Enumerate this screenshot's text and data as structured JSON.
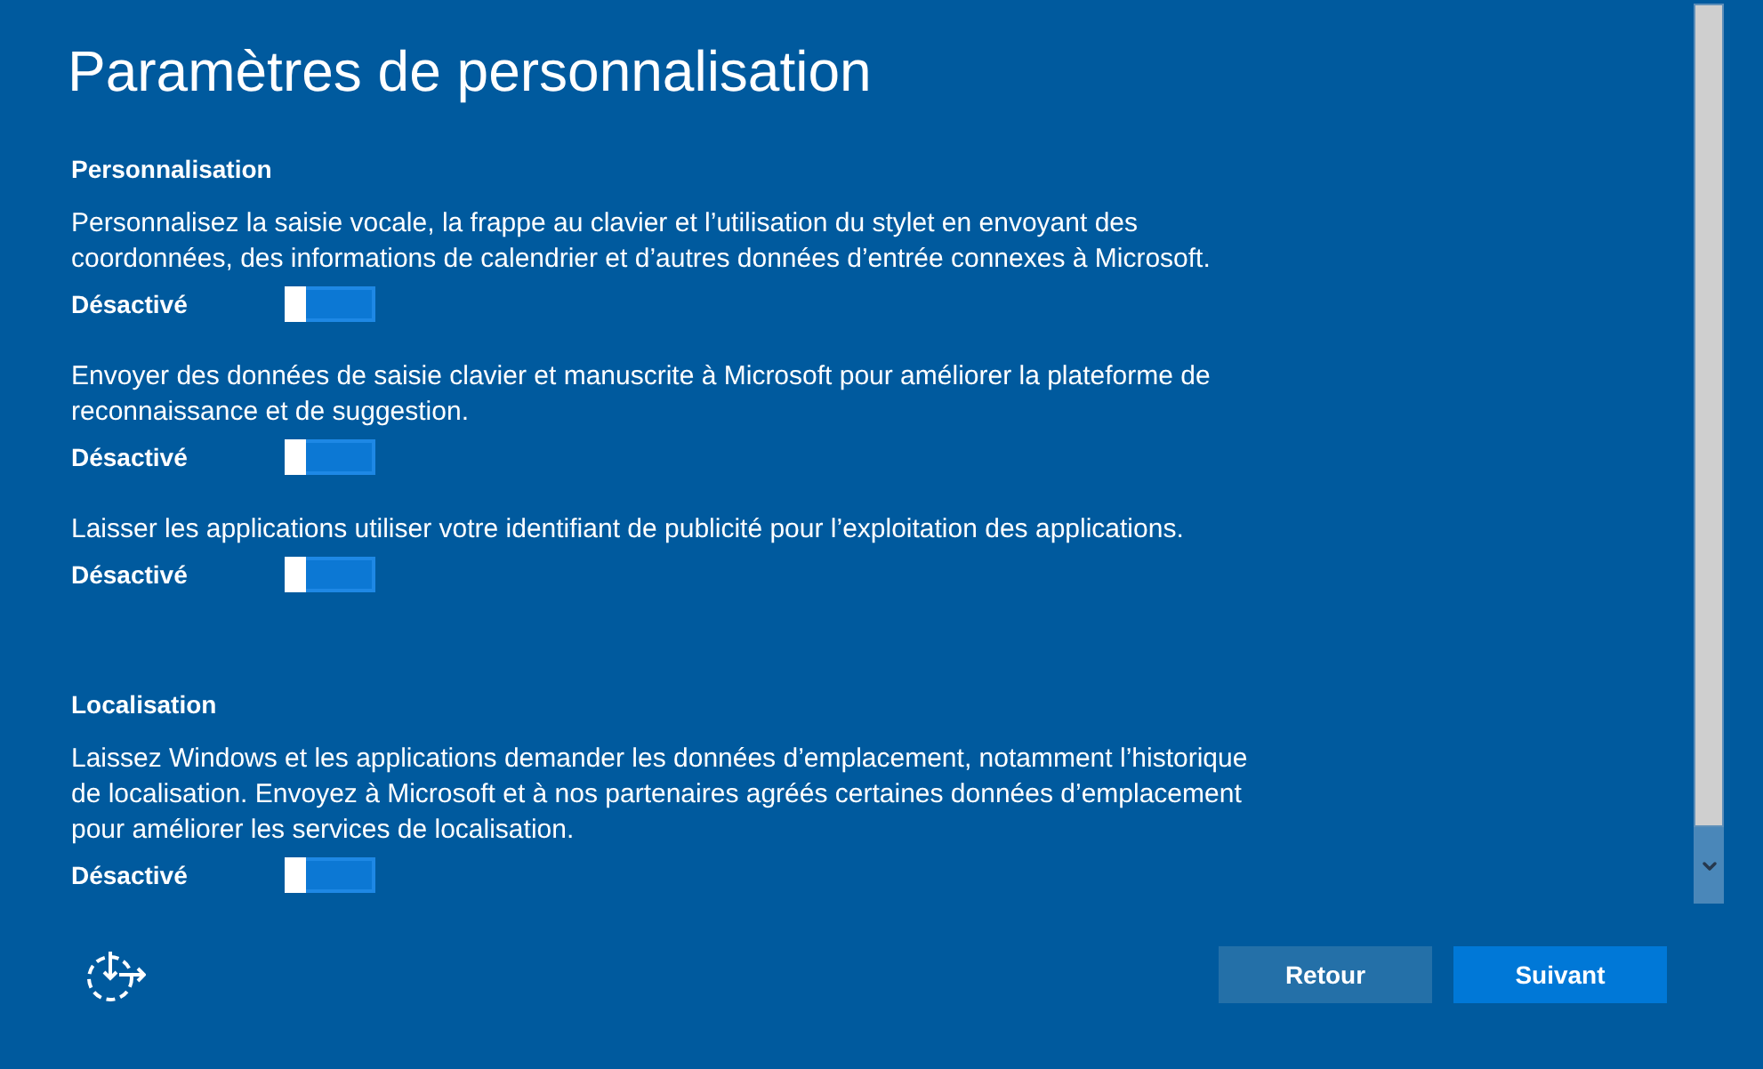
{
  "title": "Paramètres de personnalisation",
  "sections": [
    {
      "heading": "Personnalisation",
      "settings": [
        {
          "description": "Personnalisez la saisie vocale, la frappe au clavier et l’utilisation du stylet en envoyant des coordonnées, des informations de calendrier et d’autres données d’entrée connexes à Microsoft.",
          "state_label": "Désactivé",
          "on": false
        },
        {
          "description": "Envoyer des données de saisie clavier et manuscrite à Microsoft pour améliorer la plateforme de reconnaissance et de suggestion.",
          "state_label": "Désactivé",
          "on": false
        },
        {
          "description": "Laisser les applications utiliser votre identifiant de publicité pour l’exploitation des applications.",
          "state_label": "Désactivé",
          "on": false
        }
      ]
    },
    {
      "heading": "Localisation",
      "settings": [
        {
          "description": "Laissez Windows et les applications demander les données d’emplacement, notamment l’historique de localisation. Envoyez à Microsoft et à nos partenaires agréés certaines données d’emplacement pour améliorer les services de localisation.",
          "state_label": "Désactivé",
          "on": false
        }
      ]
    }
  ],
  "buttons": [
    {
      "label": "Retour",
      "kind": "secondary"
    },
    {
      "label": "Suivant",
      "kind": "primary"
    }
  ]
}
